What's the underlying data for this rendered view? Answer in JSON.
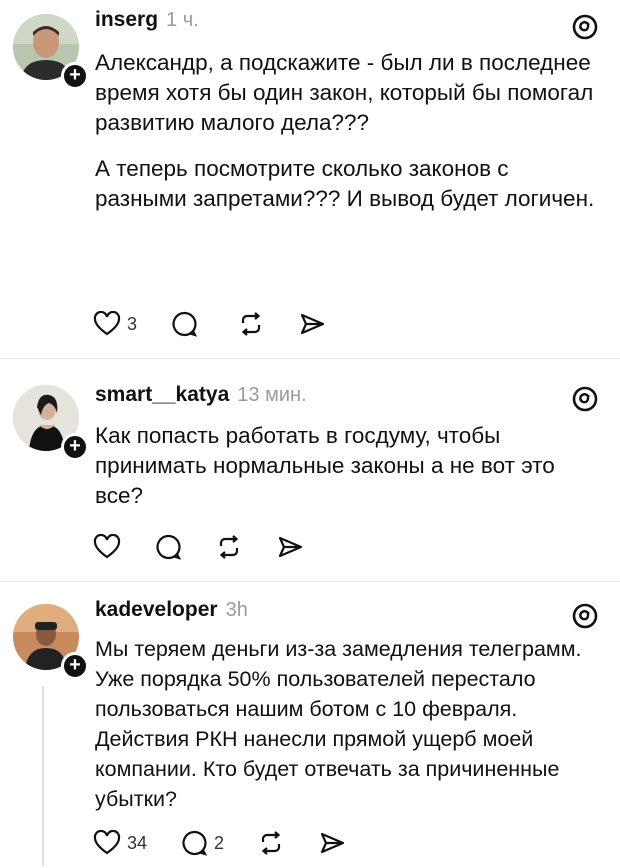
{
  "posts": [
    {
      "username": "inserg",
      "time": "1 ч.",
      "paragraphs": [
        "Александр, а подскажите - был ли в последнее время хотя бы один закон, который бы помогал развитию малого дела???",
        "А теперь посмотрите сколько законов с разными запретами??? И вывод будет логичен."
      ],
      "likes": "3",
      "replies": ""
    },
    {
      "username": "smart__katya",
      "time": "13 мин.",
      "paragraphs": [
        "Как попасть работать в госдуму, чтобы принимать нормальные законы а не вот это все?"
      ],
      "likes": "",
      "replies": ""
    },
    {
      "username": "kadeveloper",
      "time": "3h",
      "paragraphs": [
        "Мы теряем деньги из-за замедления телеграмм. Уже порядка 50% пользователей перестало пользоваться нашим ботом с 10 февраля. Действия РКН нанесли прямой ущерб моей компании. Кто будет отвечать за причиненные убытки?"
      ],
      "likes": "34",
      "replies": "2"
    }
  ],
  "icons": {
    "follow": "+",
    "like": "heart-icon",
    "reply": "comment-icon",
    "repost": "repost-icon",
    "share": "send-icon",
    "logo": "threads-logo-icon"
  },
  "colors": {
    "text": "#111111",
    "muted": "#9a9a9a",
    "divider": "#e4e4e4"
  }
}
